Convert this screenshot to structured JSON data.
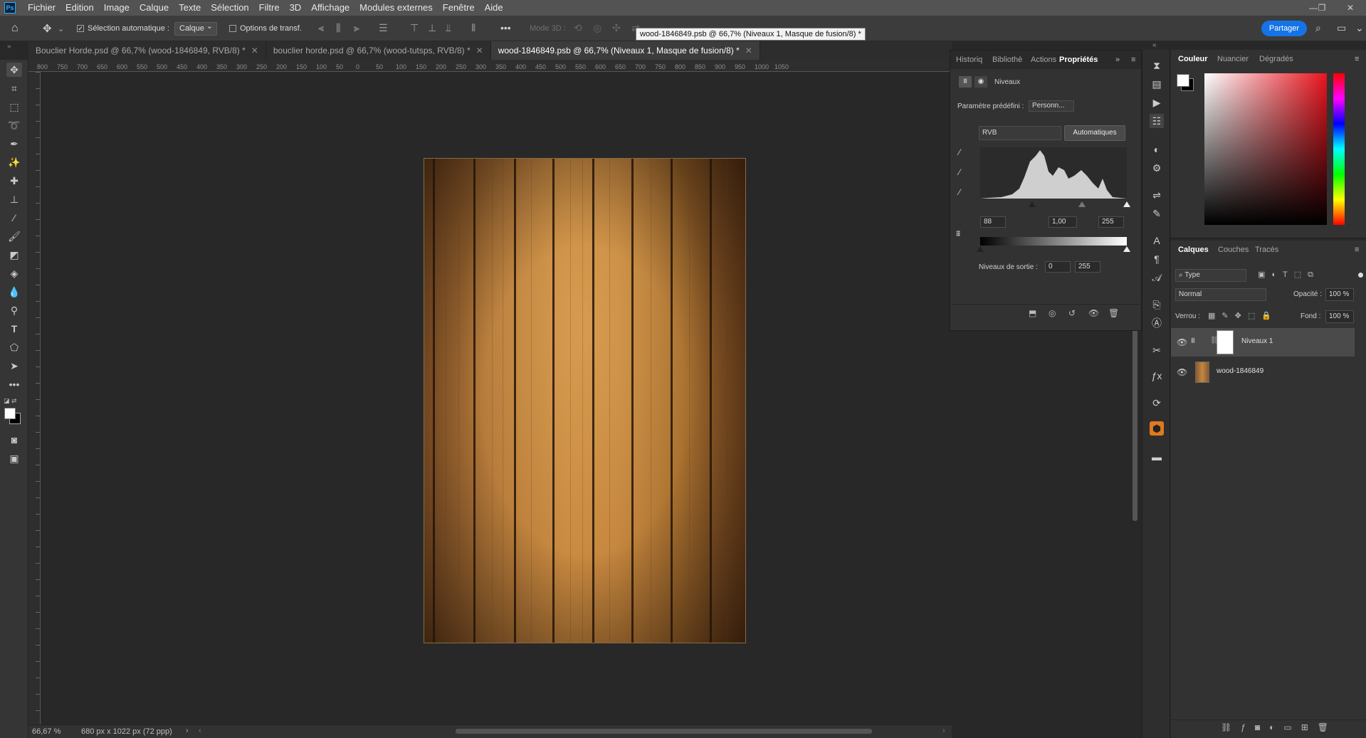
{
  "menubar": {
    "logo": "Ps",
    "items": [
      "Fichier",
      "Edition",
      "Image",
      "Calque",
      "Texte",
      "Sélection",
      "Filtre",
      "3D",
      "Affichage",
      "Modules externes",
      "Fenêtre",
      "Aide"
    ]
  },
  "options": {
    "auto_select_label": "Sélection automatique :",
    "auto_select_value": "Calque",
    "transform_label": "Options de transf.",
    "mode3d": "Mode 3D :",
    "share": "Partager"
  },
  "tabs": [
    {
      "label": "Bouclier Horde.psd @ 66,7% (wood-1846849, RVB/8) *",
      "active": false
    },
    {
      "label": "bouclier horde.psd @ 66,7% (wood-tutsps, RVB/8) *",
      "active": false
    },
    {
      "label": "wood-1846849.psb @ 66,7% (Niveaux 1, Masque de fusion/8) *",
      "active": true
    }
  ],
  "tooltip": "wood-1846849.psb @ 66,7% (Niveaux 1, Masque de fusion/8) *",
  "ruler_h": [
    "800",
    "750",
    "700",
    "650",
    "600",
    "550",
    "500",
    "450",
    "400",
    "350",
    "300",
    "250",
    "200",
    "150",
    "100",
    "50",
    "0",
    "50",
    "100",
    "150",
    "200",
    "250",
    "300",
    "350",
    "400",
    "450",
    "500",
    "550",
    "600",
    "650",
    "700",
    "750",
    "800",
    "850",
    "900",
    "950",
    "1000",
    "1050"
  ],
  "status": {
    "zoom": "66,67 %",
    "doc_info": "680 px x 1022 px (72 ppp)"
  },
  "properties": {
    "tabs": [
      "Historiq",
      "Bibliothè",
      "Actions",
      "Propriétés"
    ],
    "title": "Niveaux",
    "preset_label": "Paramètre prédéfini :",
    "preset_value": "Personn...",
    "channel": "RVB",
    "auto_button": "Automatiques",
    "input_black": "88",
    "input_gamma": "1,00",
    "input_white": "255",
    "output_label": "Niveaux de sortie :",
    "output_black": "0",
    "output_white": "255"
  },
  "color_panel": {
    "tabs": [
      "Couleur",
      "Nuancier",
      "Dégradés"
    ]
  },
  "layers_panel": {
    "tabs": [
      "Calques",
      "Couches",
      "Tracés"
    ],
    "filter": "Type",
    "blend_mode": "Normal",
    "opacity_label": "Opacité :",
    "opacity_value": "100 %",
    "lock_label": "Verrou :",
    "fill_label": "Fond :",
    "fill_value": "100 %",
    "layers": [
      {
        "name": "Niveaux 1",
        "selected": true
      },
      {
        "name": "wood-1846849",
        "selected": false
      }
    ]
  },
  "colors": {
    "accent": "#1473e6",
    "panel": "#323232",
    "canvas": "#282828"
  }
}
